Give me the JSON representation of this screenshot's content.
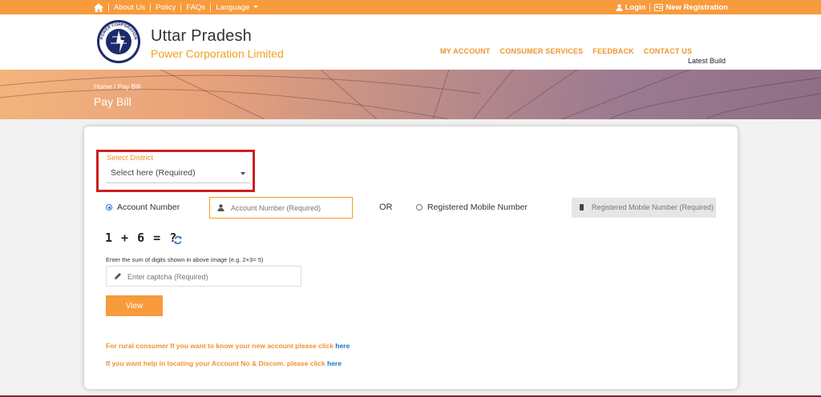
{
  "topbar": {
    "links": [
      "About Us",
      "Policy",
      "FAQs",
      "Language"
    ],
    "login": "Login",
    "new_registration": "New Registration"
  },
  "header": {
    "brand_title": "Uttar Pradesh",
    "brand_subtitle": "Power Corporation Limited",
    "logo_text": "POWER CORPORATION LIMITED",
    "nav": [
      "MY ACCOUNT",
      "CONSUMER SERVICES",
      "FEEDBACK",
      "CONTACT US"
    ],
    "latest_build": "Latest Build"
  },
  "banner": {
    "breadcrumb": "Home / Pay Bill",
    "page_title": "Pay Bill"
  },
  "form": {
    "district_label": "Select District",
    "district_value": "Select here (Required)",
    "radio_account": "Account Number",
    "account_placeholder": "Account Number (Required)",
    "or_text": "OR",
    "radio_mobile": "Registered Mobile Number",
    "mobile_placeholder": "Registered Mobile Number (Required)",
    "captcha_text": "1 + 6 = ?",
    "captcha_hint": "Enter the sum of digits shown in above image (e.g. 2+3= 5)",
    "captcha_placeholder": "Enter captcha (Required)",
    "view_button": "View",
    "note1": "For rural consumer If you want to know your new account please click",
    "note2": "If you want help in locating your Account No & Discom. please click",
    "here": "here"
  },
  "colors": {
    "accent": "#f79b3d",
    "highlight": "#cf1f1f",
    "link": "#1a73c8"
  }
}
